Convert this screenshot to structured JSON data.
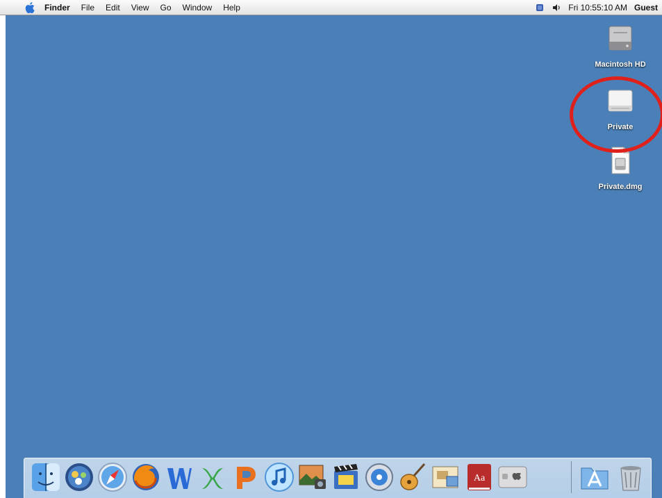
{
  "menubar": {
    "app_name": "Finder",
    "menus": [
      "File",
      "Edit",
      "View",
      "Go",
      "Window",
      "Help"
    ],
    "clock": "Fri 10:55:10 AM",
    "user": "Guest",
    "icons": [
      "apple-icon",
      "fast-user-icon",
      "volume-icon"
    ]
  },
  "desktop": {
    "icons": [
      {
        "label": "Macintosh HD",
        "icon": "hard-drive-icon"
      },
      {
        "label": "Private",
        "icon": "mounted-volume-icon"
      },
      {
        "label": "Private.dmg",
        "icon": "disk-image-file-icon"
      }
    ],
    "highlight_color": "#e0201a"
  },
  "dock": {
    "items": [
      "finder-icon",
      "dashboard-icon",
      "safari-icon",
      "firefox-icon",
      "word-icon",
      "excel-icon",
      "powerpoint-icon",
      "itunes-icon",
      "iphoto-icon",
      "imovie-icon",
      "idvd-icon",
      "garageband-icon",
      "preview-icon",
      "dictionary-icon",
      "system-preferences-icon",
      "applications-folder-icon",
      "trash-icon"
    ]
  }
}
